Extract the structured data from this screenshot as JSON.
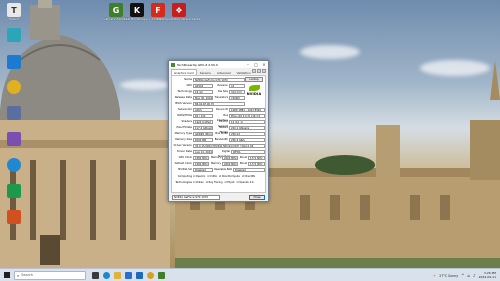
{
  "desktop_icons": [
    {
      "id": "tresorit",
      "label": "Tresorit",
      "color": "#e8e8e8",
      "glyph": "T"
    },
    {
      "id": "gpu-z",
      "label": "GPU-Z 2.50.0 (1)",
      "color": "#3f7f2a",
      "glyph": "G"
    },
    {
      "id": "kdc",
      "label": "K&D Bootstrapp...",
      "color": "#111111",
      "glyph": "K"
    },
    {
      "id": "fsd",
      "label": "FireSSD",
      "color": "#d62a1a",
      "glyph": "F"
    },
    {
      "id": "firepro",
      "label": "Eigentipptrafen Versteckentin",
      "color": "#c41e1e",
      "glyph": "❖"
    }
  ],
  "left_icons": [
    {
      "id": "recycle",
      "color": "#2aa6b8"
    },
    {
      "id": "edge",
      "color": "#1a7bd0"
    },
    {
      "id": "chrome",
      "color": "#e0b020"
    },
    {
      "id": "steam",
      "color": "#5a6ea0"
    },
    {
      "id": "app5",
      "color": "#7a4fb0"
    },
    {
      "id": "app6",
      "color": "#d24f1f"
    },
    {
      "id": "app7",
      "color": "#1a9a4a"
    },
    {
      "id": "app8",
      "color": "#2088d0"
    },
    {
      "id": "app9",
      "color": "#3a3a3a"
    }
  ],
  "window": {
    "title": "TechPowerUp GPU-Z 2.50.0",
    "tabs": [
      "Graphics Card",
      "Sensors",
      "Advanced",
      "Validation"
    ],
    "lookup_label": "Lookup",
    "logo_text": "NVIDIA",
    "rows": [
      {
        "label": "Name",
        "value": "NVIDIA GeForce GTX 1070"
      },
      {
        "label": "GPU",
        "value": "GP104",
        "sub_label": "Revision",
        "sub_value": "A1"
      },
      {
        "label": "Technology",
        "value": "16 nm",
        "sub_label": "Die Size",
        "sub_value": "314 mm²"
      },
      {
        "label": "Release Date",
        "value": "May 30, 2016",
        "sub_label": "Transistors",
        "sub_value": "7200M"
      },
      {
        "label": "BIOS Version",
        "value": "86.04.1E.00.70"
      },
      {
        "label": "Subvendor",
        "value": "ASUS",
        "sub_label": "Device ID",
        "sub_value": "10DE 1B81 - 1043 8599"
      },
      {
        "label": "ROPs/TMUs",
        "value": "64 / 120",
        "sub_label": "Bus Interface",
        "sub_value": "PCIe x16 3.0 @ x16 3.0"
      },
      {
        "label": "Shaders",
        "value": "1920 Unified",
        "sub_label": "DirectX Support",
        "sub_value": "12 (12_1)"
      },
      {
        "label": "Pixel Fillrate",
        "value": "117.4 GPixel/s",
        "sub_label": "Texture Fillrate",
        "sub_value": "220.1 GTexel/s"
      },
      {
        "label": "Memory Type",
        "value": "GDDR5 (Micron)",
        "sub_label": "Bus Width",
        "sub_value": "256 bit"
      },
      {
        "label": "Memory Size",
        "value": "8192 MB",
        "sub_label": "Bandwidth",
        "sub_value": "256.3 GB/s"
      },
      {
        "label": "Driver Version",
        "value": "32.0.15.6094 (NVIDIA 560.94) DCH / Win11 64"
      },
      {
        "label": "Driver Date",
        "value": "Aug 14, 2024",
        "sub_label": "Digital Signature",
        "sub_value": "WHQL"
      },
      {
        "label": "GPU Clock",
        "value": "1582 MHz",
        "sub_label": "Memory",
        "sub_value": "2002 MHz",
        "sub2_label": "Boost",
        "sub2_value": "1771 MHz"
      },
      {
        "label": "Default Clock",
        "value": "1582 MHz",
        "sub_label": "Memory",
        "sub_value": "2002 MHz",
        "sub2_label": "Boost",
        "sub2_value": "1771 MHz"
      },
      {
        "label": "NVIDIA SLI",
        "value": "Disabled",
        "sub_label": "Resizable BAR",
        "sub_value": "Disabled"
      }
    ],
    "computing_label": "Computing",
    "computing": [
      "OpenCL",
      "CUDA",
      "DirectCompute",
      "DirectML"
    ],
    "technologies_label": "Technologies",
    "technologies": [
      "Vulkan",
      "Ray Tracing",
      "PhysX",
      "OpenGL 4.6"
    ],
    "gpu_select": "NVIDIA GeForce GTX 1070",
    "close_label": "Close"
  },
  "taskbar": {
    "search_placeholder": "Search",
    "pinned": [
      {
        "id": "task-view",
        "color": "#3a3a3a"
      },
      {
        "id": "edge",
        "color": "#1a8ad0"
      },
      {
        "id": "explorer",
        "color": "#e0b23a"
      },
      {
        "id": "store",
        "color": "#2a6fd0"
      },
      {
        "id": "mail",
        "color": "#1a6ac0"
      },
      {
        "id": "chrome",
        "color": "#d8a020"
      },
      {
        "id": "gpu-z",
        "color": "#3f7f2a"
      }
    ],
    "weather": "27°C Sunny",
    "time": "3:26 PM",
    "date": "2024-09-11"
  }
}
